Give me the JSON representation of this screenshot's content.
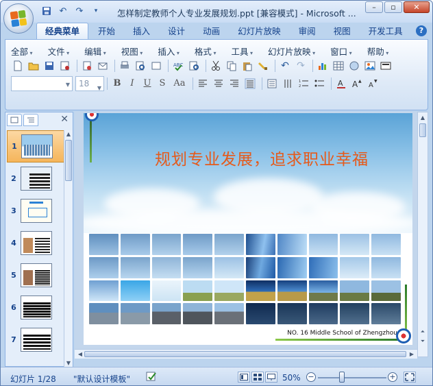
{
  "window": {
    "title": "怎样制定教师个人专业发展规划.ppt [兼容模式] - Microsoft ...",
    "controls": {
      "minimize": "–",
      "restore": "▫",
      "close": "✕"
    }
  },
  "quick_access": [
    "save-icon",
    "undo-icon",
    "redo-icon",
    "customize-icon"
  ],
  "ribbon": {
    "tabs": [
      "经典菜单",
      "开始",
      "插入",
      "设计",
      "动画",
      "幻灯片放映",
      "审阅",
      "视图",
      "开发工具"
    ],
    "active_tab": "经典菜单",
    "help": "?",
    "menus": [
      "全部",
      "文件",
      "编辑",
      "视图",
      "插入",
      "格式",
      "工具",
      "幻灯片放映",
      "窗口",
      "帮助"
    ],
    "font_name_value": "",
    "font_size_value": "18",
    "format_buttons": {
      "bold": "B",
      "italic": "I",
      "underline": "U",
      "strike": "S",
      "case": "Aa"
    }
  },
  "slides_panel": {
    "tab_icons": [
      "slides-tab-icon",
      "outline-tab-icon"
    ],
    "close": "✕",
    "slides": [
      {
        "num": "1",
        "selected": true
      },
      {
        "num": "2",
        "selected": false
      },
      {
        "num": "3",
        "selected": false
      },
      {
        "num": "4",
        "selected": false
      },
      {
        "num": "5",
        "selected": false
      },
      {
        "num": "6",
        "selected": false
      },
      {
        "num": "7",
        "selected": false
      }
    ]
  },
  "slide": {
    "title": "规划专业发展，追求职业幸福",
    "footer": "NO. 16 Middle  School of  Zhengzhou"
  },
  "status": {
    "slide_counter": "幻灯片 1/28",
    "theme": "\"默认设计模板\"",
    "zoom": "50%",
    "zoom_level_fraction": 0.35
  }
}
